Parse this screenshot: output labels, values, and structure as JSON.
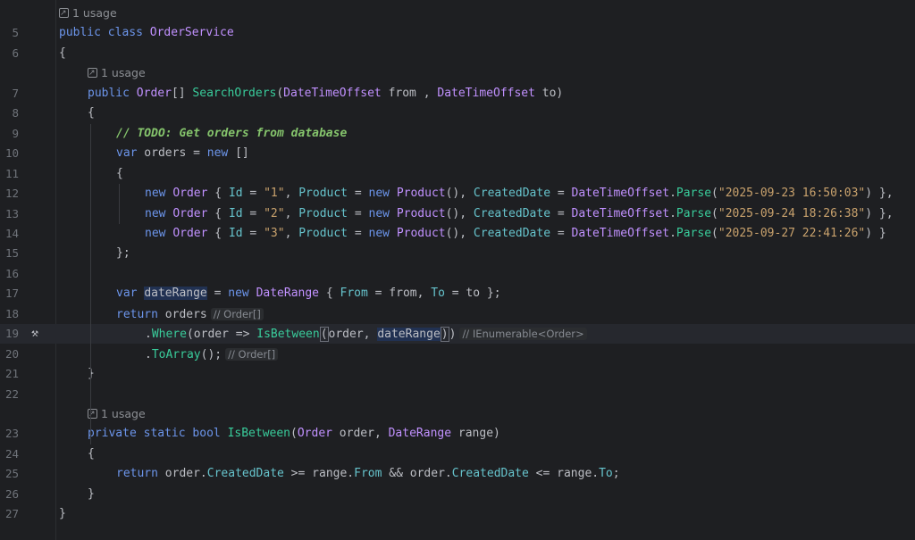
{
  "editor": {
    "usage_label": "1 usage",
    "usage_icon": "external-link-icon",
    "lines": [
      {
        "n": "5",
        "indent": 0,
        "usage_before": true,
        "tokens": [
          [
            "kw",
            "public"
          ],
          [
            "t",
            " "
          ],
          [
            "kw",
            "class"
          ],
          [
            "t",
            " "
          ],
          [
            "type",
            "OrderService"
          ]
        ]
      },
      {
        "n": "6",
        "indent": 0,
        "tokens": [
          [
            "t",
            "{"
          ]
        ]
      },
      {
        "n": "7",
        "indent": 1,
        "usage_before": true,
        "tokens": [
          [
            "kw",
            "public"
          ],
          [
            "t",
            " "
          ],
          [
            "type",
            "Order"
          ],
          [
            "t",
            "[] "
          ],
          [
            "method",
            "SearchOrders"
          ],
          [
            "t",
            "("
          ],
          [
            "type",
            "DateTimeOffset"
          ],
          [
            "t",
            " from , "
          ],
          [
            "type",
            "DateTimeOffset"
          ],
          [
            "t",
            " to)"
          ]
        ]
      },
      {
        "n": "8",
        "indent": 1,
        "tokens": [
          [
            "t",
            "{"
          ]
        ]
      },
      {
        "n": "9",
        "indent": 2,
        "tokens": [
          [
            "cmt",
            "// TODO: Get orders from database"
          ]
        ]
      },
      {
        "n": "10",
        "indent": 2,
        "tokens": [
          [
            "kw",
            "var"
          ],
          [
            "t",
            " orders = "
          ],
          [
            "kw",
            "new"
          ],
          [
            "t",
            " []"
          ]
        ]
      },
      {
        "n": "11",
        "indent": 2,
        "tokens": [
          [
            "t",
            "{"
          ]
        ]
      },
      {
        "n": "12",
        "indent": 3,
        "tokens": [
          [
            "kw",
            "new"
          ],
          [
            "t",
            " "
          ],
          [
            "type",
            "Order"
          ],
          [
            "t",
            " { "
          ],
          [
            "prop",
            "Id"
          ],
          [
            "t",
            " = "
          ],
          [
            "str",
            "\"1\""
          ],
          [
            "t",
            ", "
          ],
          [
            "prop",
            "Product"
          ],
          [
            "t",
            " = "
          ],
          [
            "kw",
            "new"
          ],
          [
            "t",
            " "
          ],
          [
            "type",
            "Product"
          ],
          [
            "t",
            "(), "
          ],
          [
            "prop",
            "CreatedDate"
          ],
          [
            "t",
            " = "
          ],
          [
            "type",
            "DateTimeOffset"
          ],
          [
            "t",
            "."
          ],
          [
            "method",
            "Parse"
          ],
          [
            "t",
            "("
          ],
          [
            "str",
            "\"2025-09-23 16:50:03\""
          ],
          [
            "t",
            ") },"
          ]
        ]
      },
      {
        "n": "13",
        "indent": 3,
        "tokens": [
          [
            "kw",
            "new"
          ],
          [
            "t",
            " "
          ],
          [
            "type",
            "Order"
          ],
          [
            "t",
            " { "
          ],
          [
            "prop",
            "Id"
          ],
          [
            "t",
            " = "
          ],
          [
            "str",
            "\"2\""
          ],
          [
            "t",
            ", "
          ],
          [
            "prop",
            "Product"
          ],
          [
            "t",
            " = "
          ],
          [
            "kw",
            "new"
          ],
          [
            "t",
            " "
          ],
          [
            "type",
            "Product"
          ],
          [
            "t",
            "(), "
          ],
          [
            "prop",
            "CreatedDate"
          ],
          [
            "t",
            " = "
          ],
          [
            "type",
            "DateTimeOffset"
          ],
          [
            "t",
            "."
          ],
          [
            "method",
            "Parse"
          ],
          [
            "t",
            "("
          ],
          [
            "str",
            "\"2025-09-24 18:26:38\""
          ],
          [
            "t",
            ") },"
          ]
        ]
      },
      {
        "n": "14",
        "indent": 3,
        "tokens": [
          [
            "kw",
            "new"
          ],
          [
            "t",
            " "
          ],
          [
            "type",
            "Order"
          ],
          [
            "t",
            " { "
          ],
          [
            "prop",
            "Id"
          ],
          [
            "t",
            " = "
          ],
          [
            "str",
            "\"3\""
          ],
          [
            "t",
            ", "
          ],
          [
            "prop",
            "Product"
          ],
          [
            "t",
            " = "
          ],
          [
            "kw",
            "new"
          ],
          [
            "t",
            " "
          ],
          [
            "type",
            "Product"
          ],
          [
            "t",
            "(), "
          ],
          [
            "prop",
            "CreatedDate"
          ],
          [
            "t",
            " = "
          ],
          [
            "type",
            "DateTimeOffset"
          ],
          [
            "t",
            "."
          ],
          [
            "method",
            "Parse"
          ],
          [
            "t",
            "("
          ],
          [
            "str",
            "\"2025-09-27 22:41:26\""
          ],
          [
            "t",
            ") }"
          ]
        ]
      },
      {
        "n": "15",
        "indent": 2,
        "tokens": [
          [
            "t",
            "};"
          ]
        ]
      },
      {
        "n": "16",
        "indent": 0,
        "tokens": []
      },
      {
        "n": "17",
        "indent": 2,
        "tokens": [
          [
            "kw",
            "var"
          ],
          [
            "t",
            " "
          ],
          [
            "hl",
            "dateRange"
          ],
          [
            "t",
            " = "
          ],
          [
            "kw",
            "new"
          ],
          [
            "t",
            " "
          ],
          [
            "type",
            "DateRange"
          ],
          [
            "t",
            " { "
          ],
          [
            "prop",
            "From"
          ],
          [
            "t",
            " = from, "
          ],
          [
            "prop",
            "To"
          ],
          [
            "t",
            " = to };"
          ]
        ]
      },
      {
        "n": "18",
        "indent": 2,
        "tokens": [
          [
            "kw",
            "return"
          ],
          [
            "t",
            " orders"
          ],
          [
            "hint",
            "// Order[]"
          ]
        ]
      },
      {
        "n": "19",
        "indent": 3,
        "current": true,
        "gutter_icon": "hammer-icon",
        "tokens": [
          [
            "t",
            "."
          ],
          [
            "method",
            "Where"
          ],
          [
            "t",
            "(order => "
          ],
          [
            "method",
            "IsBetween"
          ],
          [
            "brk",
            "("
          ],
          [
            "t",
            "order, "
          ],
          [
            "hl",
            "dateRange"
          ],
          [
            "brk",
            ")"
          ],
          [
            "t",
            ")"
          ],
          [
            "hint",
            "// IEnumerable<Order>"
          ]
        ]
      },
      {
        "n": "20",
        "indent": 3,
        "tokens": [
          [
            "t",
            "."
          ],
          [
            "method",
            "ToArray"
          ],
          [
            "t",
            "();"
          ],
          [
            "hint",
            "// Order[]"
          ]
        ]
      },
      {
        "n": "21",
        "indent": 1,
        "tokens": [
          [
            "t",
            "}"
          ]
        ]
      },
      {
        "n": "22",
        "indent": 0,
        "tokens": []
      },
      {
        "n": "23",
        "indent": 1,
        "usage_before": true,
        "tokens": [
          [
            "kw",
            "private"
          ],
          [
            "t",
            " "
          ],
          [
            "kw",
            "static"
          ],
          [
            "t",
            " "
          ],
          [
            "kw",
            "bool"
          ],
          [
            "t",
            " "
          ],
          [
            "method",
            "IsBetween"
          ],
          [
            "t",
            "("
          ],
          [
            "type",
            "Order"
          ],
          [
            "t",
            " order, "
          ],
          [
            "type",
            "DateRange"
          ],
          [
            "t",
            " range)"
          ]
        ]
      },
      {
        "n": "24",
        "indent": 1,
        "tokens": [
          [
            "t",
            "{"
          ]
        ]
      },
      {
        "n": "25",
        "indent": 2,
        "tokens": [
          [
            "kw",
            "return"
          ],
          [
            "t",
            " order."
          ],
          [
            "prop",
            "CreatedDate"
          ],
          [
            "t",
            " >= range."
          ],
          [
            "prop",
            "From"
          ],
          [
            "t",
            " && order."
          ],
          [
            "prop",
            "CreatedDate"
          ],
          [
            "t",
            " <= range."
          ],
          [
            "prop",
            "To"
          ],
          [
            "t",
            ";"
          ]
        ]
      },
      {
        "n": "26",
        "indent": 1,
        "tokens": [
          [
            "t",
            "}"
          ]
        ]
      },
      {
        "n": "27",
        "indent": 0,
        "tokens": [
          [
            "t",
            "}"
          ]
        ]
      }
    ]
  }
}
